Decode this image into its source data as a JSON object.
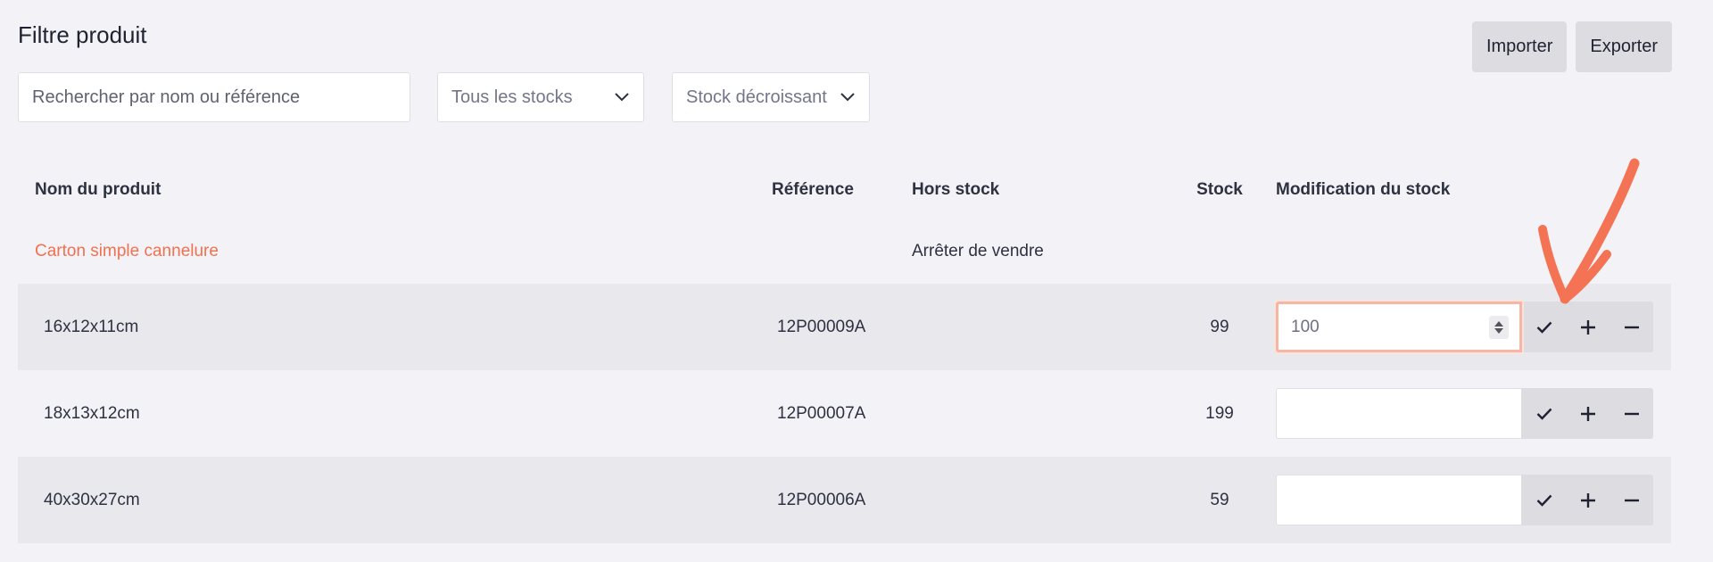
{
  "filter": {
    "title": "Filtre produit",
    "search_placeholder": "Rechercher par nom ou référence",
    "stock_select": "Tous les stocks",
    "sort_select": "Stock décroissant"
  },
  "actions": {
    "import_label": "Importer",
    "export_label": "Exporter"
  },
  "table": {
    "headers": {
      "name": "Nom du produit",
      "reference": "Référence",
      "hors_stock": "Hors stock",
      "stock": "Stock",
      "modification": "Modification du stock"
    },
    "group": {
      "name": "Carton simple cannelure",
      "hors_stock": "Arrêter de vendre"
    },
    "rows": [
      {
        "name": "16x12x11cm",
        "reference": "12P00009A",
        "stock": "99",
        "input_value": "100"
      },
      {
        "name": "18x13x12cm",
        "reference": "12P00007A",
        "stock": "199",
        "input_value": ""
      },
      {
        "name": "40x30x27cm",
        "reference": "12P00006A",
        "stock": "59",
        "input_value": ""
      }
    ]
  },
  "icons": {
    "confirm": "check-icon",
    "increment": "plus-icon",
    "decrement": "minus-icon",
    "dropdown": "chevron-down-icon",
    "annotation": "arrow-annotation"
  },
  "colors": {
    "accent": "#f2704f",
    "focus_border": "#f7b5a6",
    "row_shaded": "#e8e8ed",
    "button_gray": "#dcdce1",
    "background": "#f3f3f7"
  }
}
